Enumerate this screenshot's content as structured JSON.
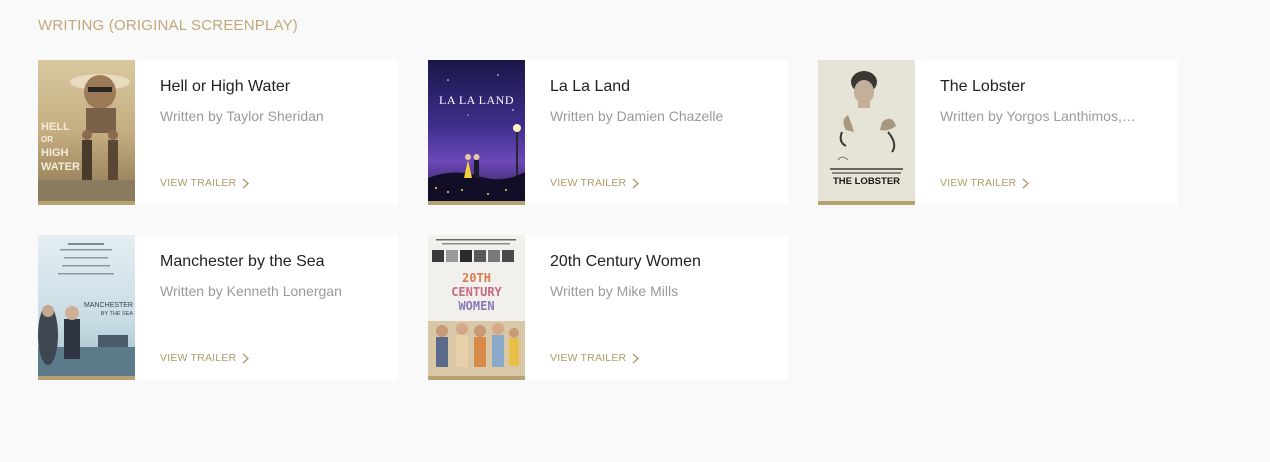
{
  "section": {
    "title": "WRITING (ORIGINAL SCREENPLAY)"
  },
  "nominees": [
    {
      "title": "Hell or High Water",
      "credit": "Written by Taylor Sheridan",
      "trailer_label": "VIEW TRAILER",
      "poster_text": [
        "HELL",
        "OR",
        "HIGH",
        "WATER"
      ]
    },
    {
      "title": "La La Land",
      "credit": "Written by Damien Chazelle",
      "trailer_label": "VIEW TRAILER",
      "poster_text": [
        "LA LA LAND"
      ]
    },
    {
      "title": "The Lobster",
      "credit": "Written by Yorgos Lanthimos,…",
      "trailer_label": "VIEW TRAILER",
      "poster_text": [
        "THE LOBSTER"
      ]
    },
    {
      "title": "Manchester by the Sea",
      "credit": "Written by Kenneth Lonergan",
      "trailer_label": "VIEW TRAILER",
      "poster_text": [
        "MANCHESTER",
        "BY THE SEA"
      ]
    },
    {
      "title": "20th Century Women",
      "credit": "Written by Mike Mills",
      "trailer_label": "VIEW TRAILER",
      "poster_text": [
        "20TH",
        "CENTURY",
        "WOMEN"
      ]
    }
  ],
  "colors": {
    "background": "#f9f9f9",
    "card": "#ffffff",
    "accent_gold": "#b6a171",
    "section_title": "#c0a97a"
  }
}
